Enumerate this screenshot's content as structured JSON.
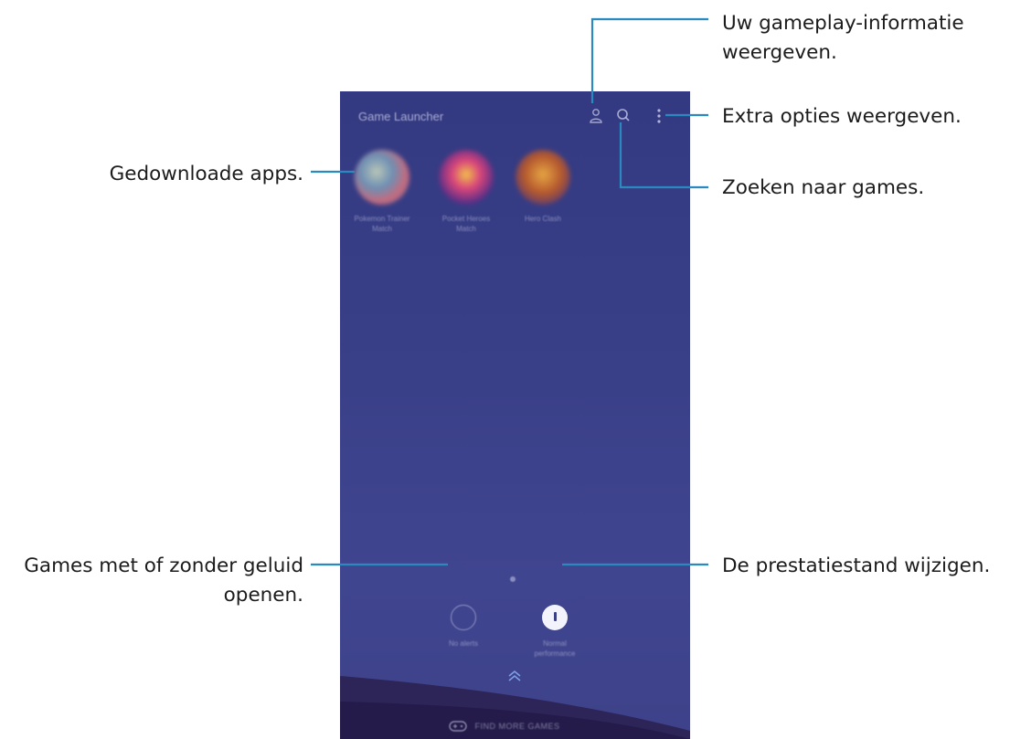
{
  "phone": {
    "app_title": "Game Launcher",
    "top_icons": [
      "profile-icon",
      "search-icon",
      "more-vertical-icon"
    ],
    "apps": [
      {
        "label_line1": "Pokemon Trainer",
        "label_line2": "Match"
      },
      {
        "label_line1": "Pocket Heroes",
        "label_line2": "Match"
      },
      {
        "label_line1": "Hero Clash",
        "label_line2": ""
      }
    ],
    "quick_buttons": {
      "mute_label": "No alerts",
      "perf_label_line1": "Normal",
      "perf_label_line2": "performance"
    },
    "find_more_label": "FIND MORE GAMES",
    "colors": {
      "background": "#3a4088",
      "bottom_strip": "#2a1f52",
      "accent": "#f3f4fb"
    }
  },
  "callouts": {
    "gameplay_info_line1": "Uw gameplay-informatie",
    "gameplay_info_line2": "weergeven.",
    "extra_options": "Extra opties weergeven.",
    "search_games": "Zoeken naar games.",
    "downloaded_apps": "Gedownloade apps.",
    "sound_line1": "Games met of zonder geluid",
    "sound_line2": "openen.",
    "performance_mode": "De prestatiestand wijzigen."
  },
  "leader_color": "#2a8ac0"
}
